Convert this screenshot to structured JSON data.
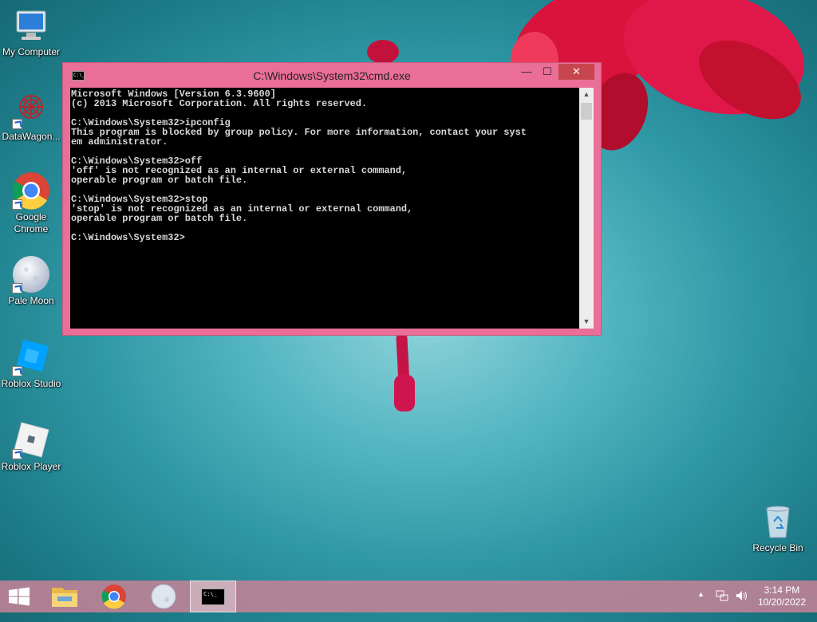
{
  "desktop": {
    "icons": [
      {
        "label": "My Computer",
        "icon": "computer-icon"
      },
      {
        "label": "DataWagon...",
        "icon": "datawagon-icon"
      },
      {
        "label": "Google Chrome",
        "icon": "chrome-icon"
      },
      {
        "label": "Pale Moon",
        "icon": "palemoon-icon"
      },
      {
        "label": "Roblox Studio",
        "icon": "roblox-studio-icon"
      },
      {
        "label": "Roblox Player",
        "icon": "roblox-player-icon"
      },
      {
        "label": "Recycle Bin",
        "icon": "recycle-bin-icon"
      }
    ]
  },
  "cmd_window": {
    "title": "C:\\Windows\\System32\\cmd.exe",
    "title_icon_text": "C:\\_",
    "buttons": {
      "minimize": "—",
      "maximize": "☐",
      "close": "✕"
    },
    "console_lines": [
      "Microsoft Windows [Version 6.3.9600]",
      "(c) 2013 Microsoft Corporation. All rights reserved.",
      "",
      "C:\\Windows\\System32>ipconfig",
      "This program is blocked by group policy. For more information, contact your syst",
      "em administrator.",
      "",
      "C:\\Windows\\System32>off",
      "'off' is not recognized as an internal or external command,",
      "operable program or batch file.",
      "",
      "C:\\Windows\\System32>stop",
      "'stop' is not recognized as an internal or external command,",
      "operable program or batch file.",
      "",
      "C:\\Windows\\System32>"
    ],
    "scroll_up": "▲",
    "scroll_down": "▼"
  },
  "taskbar": {
    "start_icon": "windows-logo-icon",
    "pinned": [
      "file-explorer-icon",
      "chrome-icon",
      "palemoon-icon",
      "cmd-icon"
    ],
    "active_icon_text": "C:\\_",
    "tray": {
      "show_hidden": "▲",
      "network": "network-icon",
      "volume": "volume-icon"
    },
    "time": "3:14 PM",
    "date": "10/20/2022"
  },
  "colors": {
    "window_frame": "#ea6e97",
    "close_button": "#c7464d",
    "console_bg": "#000000",
    "console_text": "#d8d8d8"
  }
}
